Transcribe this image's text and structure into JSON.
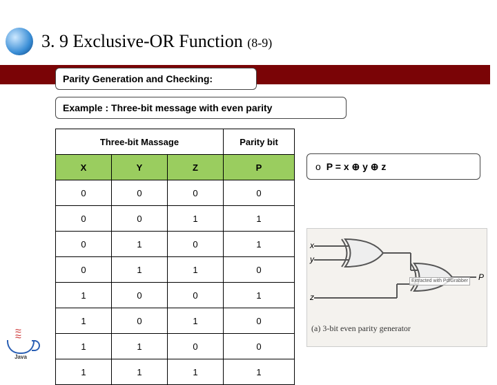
{
  "title": {
    "main": "3. 9 Exclusive-OR Function",
    "suffix": "(8-9)"
  },
  "callouts": {
    "box1": "Parity Generation and Checking:",
    "box2": "Example : Three-bit message with even parity"
  },
  "table": {
    "group_msg": "Three-bit Massage",
    "group_parity": "Parity bit",
    "head": {
      "x": "X",
      "y": "Y",
      "z": "Z",
      "p": "P"
    },
    "rows": [
      {
        "x": "0",
        "y": "0",
        "z": "0",
        "p": "0"
      },
      {
        "x": "0",
        "y": "0",
        "z": "1",
        "p": "1"
      },
      {
        "x": "0",
        "y": "1",
        "z": "0",
        "p": "1"
      },
      {
        "x": "0",
        "y": "1",
        "z": "1",
        "p": "0"
      },
      {
        "x": "1",
        "y": "0",
        "z": "0",
        "p": "1"
      },
      {
        "x": "1",
        "y": "0",
        "z": "1",
        "p": "0"
      },
      {
        "x": "1",
        "y": "1",
        "z": "0",
        "p": "0"
      },
      {
        "x": "1",
        "y": "1",
        "z": "1",
        "p": "1"
      }
    ]
  },
  "formula": {
    "bullet": "o",
    "text": "P = x ⊕ y ⊕ z"
  },
  "diagram": {
    "in_x": "x",
    "in_y": "y",
    "in_z": "z",
    "out_p": "P",
    "extracted": "Extracted with PdfGrabber",
    "caption": "(a) 3-bit even parity generator"
  },
  "java": {
    "label": "Java"
  }
}
